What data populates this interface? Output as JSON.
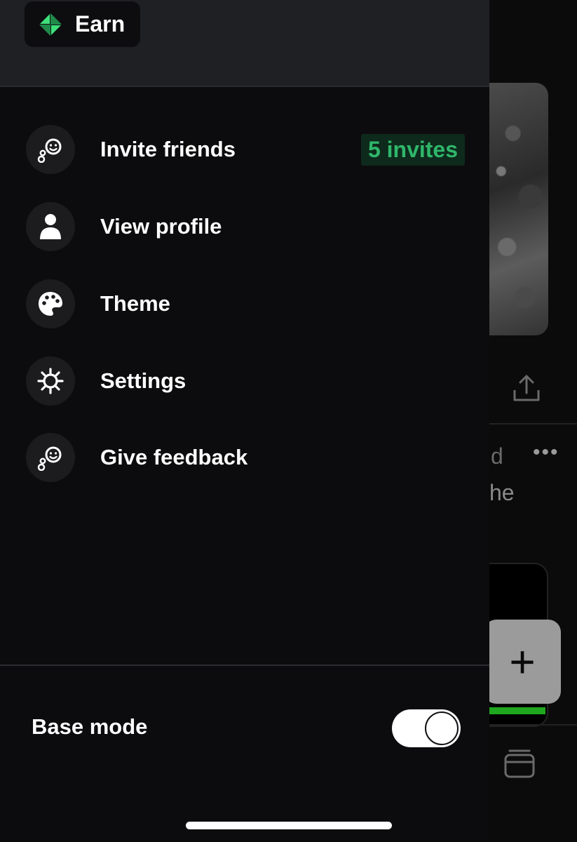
{
  "header": {
    "earn_label": "Earn"
  },
  "menu": {
    "items": [
      {
        "label": "Invite friends",
        "icon": "invite-friends-icon",
        "badge": "5 invites"
      },
      {
        "label": "View profile",
        "icon": "profile-icon"
      },
      {
        "label": "Theme",
        "icon": "palette-icon"
      },
      {
        "label": "Settings",
        "icon": "gear-icon"
      },
      {
        "label": "Give feedback",
        "icon": "feedback-icon"
      }
    ]
  },
  "footer": {
    "base_mode_label": "Base mode",
    "base_mode_enabled": true
  },
  "background": {
    "visible_text_1": "d",
    "visible_text_2": "he",
    "fab_label": "+"
  },
  "colors": {
    "drawer_bg": "#0c0c0e",
    "header_bg": "#1f2024",
    "badge_text": "#2fb66a",
    "badge_bg": "#0e2a1c",
    "earn_icon": "#3ee07a"
  }
}
